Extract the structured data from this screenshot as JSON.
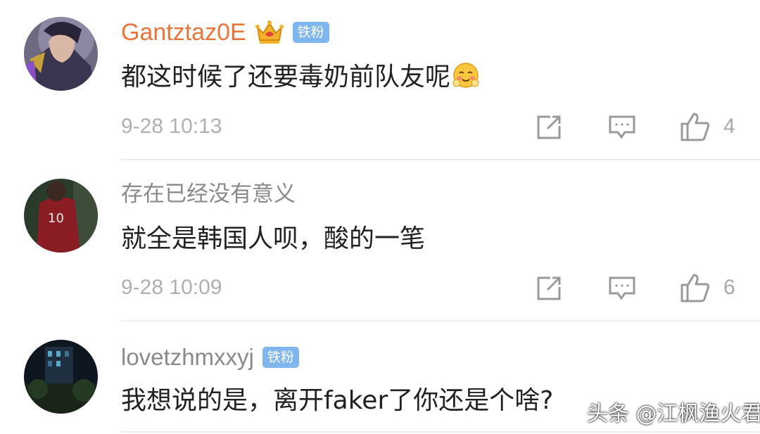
{
  "comments": [
    {
      "username": "Gantztaz0E",
      "badge": "铁粉",
      "has_crown": true,
      "text": "都这时候了还要毒奶前队友呢",
      "emoji": "blush-emoji",
      "time": "9-28 10:13",
      "likes": "4",
      "username_color": "#e8763a"
    },
    {
      "username": "存在已经没有意义",
      "text": "就全是韩国人呗，酸的一笔",
      "time": "9-28 10:09",
      "likes": "6",
      "username_color": "#8a8a8a"
    },
    {
      "username": "lovetzhmxxyj",
      "badge": "铁粉",
      "text": "我想说的是，离开faker了你还是个啥?",
      "username_color": "#8a8a8a"
    }
  ],
  "icons": {
    "share": "share-icon",
    "comment": "comment-icon",
    "like": "thumbs-up-icon",
    "crown": "crown-icon"
  },
  "watermark": "头条 @江枫渔火君",
  "colors": {
    "badge_bg": "#7fb6ee",
    "text": "#222222",
    "meta": "#b0b0b0",
    "icon": "#9a9a9a"
  }
}
